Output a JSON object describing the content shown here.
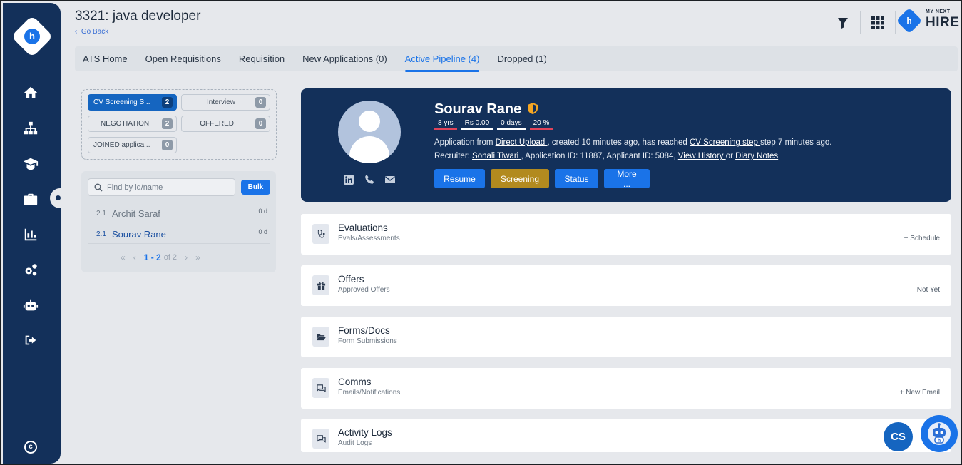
{
  "header": {
    "title": "3321: java developer",
    "go_back": "Go Back",
    "brand_small": "MY NEXT",
    "brand_big": "HIRE"
  },
  "tabs": [
    {
      "label": "ATS Home"
    },
    {
      "label": "Open Requisitions"
    },
    {
      "label": "Requisition"
    },
    {
      "label": "New Applications (0)"
    },
    {
      "label": "Active Pipeline (4)"
    },
    {
      "label": "Dropped (1)"
    }
  ],
  "stages": [
    {
      "label": "CV Screening S...",
      "count": "2"
    },
    {
      "label": "Interview",
      "count": "0"
    },
    {
      "label": "NEGOTIATION",
      "count": "2"
    },
    {
      "label": "OFFERED",
      "count": "0"
    },
    {
      "label": "JOINED applica...",
      "count": "0"
    }
  ],
  "list": {
    "search_placeholder": "Find by id/name",
    "bulk_label": "Bulk",
    "candidates": [
      {
        "num": "2.1",
        "name": "Archit Saraf",
        "age": "0 d"
      },
      {
        "num": "2.1",
        "name": "Sourav Rane",
        "age": "0 d"
      }
    ],
    "pager": {
      "range": "1 - 2",
      "of": "of 2",
      "first": "«",
      "prev": "‹",
      "next": "›",
      "last": "»"
    }
  },
  "profile": {
    "name": "Sourav Rane",
    "chips": [
      "8 yrs",
      "Rs 0.00",
      "0 days",
      "20 %"
    ],
    "line1": {
      "pre": "Application from ",
      "source": "Direct Upload ",
      "mid": ", created 10 minutes ago, has reached ",
      "stage": "CV Screening step ",
      "post": "step 7 minutes ago."
    },
    "line2": {
      "pre": "Recruiter: ",
      "recruiter": "Sonali Tiwari ",
      "mid": ", Application ID: 11887, Applicant ID: 5084, ",
      "history": "View History ",
      "or": "or ",
      "diary": "Diary Notes"
    },
    "buttons": {
      "resume": "Resume",
      "screening": "Screening",
      "status": "Status",
      "more": "More ..."
    }
  },
  "sections": [
    {
      "title": "Evaluations",
      "sub": "Evals/Assessments",
      "action": "+ Schedule"
    },
    {
      "title": "Offers",
      "sub": "Approved Offers",
      "action": "Not Yet"
    },
    {
      "title": "Forms/Docs",
      "sub": "Form Submissions",
      "action": ""
    },
    {
      "title": "Comms",
      "sub": "Emails/Notifications",
      "action": "+  New Email"
    },
    {
      "title": "Activity Logs",
      "sub": "Audit Logs",
      "action": ""
    }
  ],
  "floating": {
    "cs_label": "CS"
  },
  "colors": {
    "sidebar": "#13305a",
    "accent": "#1a73e8",
    "screening": "#b28a1f",
    "chip_red": "#e0445a"
  }
}
